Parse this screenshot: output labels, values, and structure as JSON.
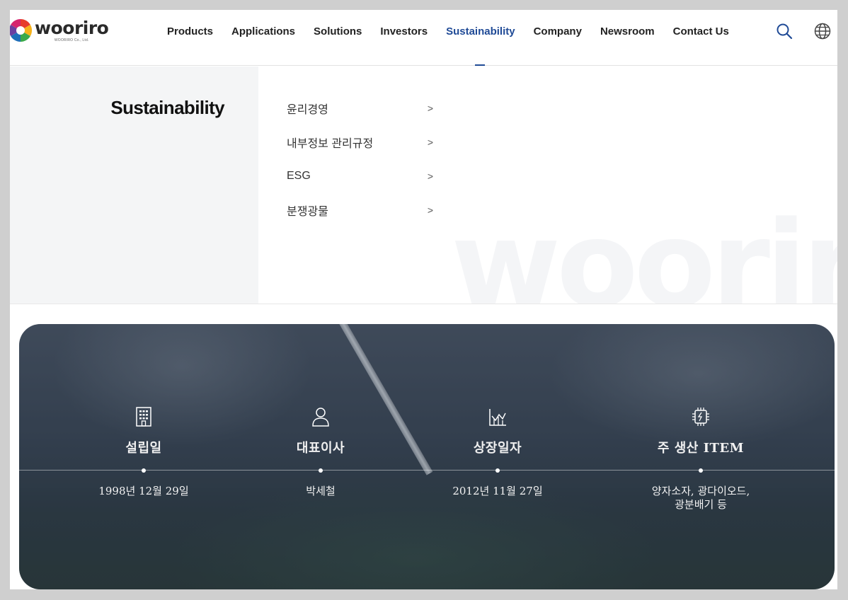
{
  "header": {
    "logo": {
      "name": "wooriro",
      "sub": "WOORIRO Co., Ltd."
    },
    "nav": [
      {
        "label": "Products"
      },
      {
        "label": "Applications"
      },
      {
        "label": "Solutions"
      },
      {
        "label": "Investors"
      },
      {
        "label": "Sustainability",
        "active": true
      },
      {
        "label": "Company"
      },
      {
        "label": "Newsroom"
      },
      {
        "label": "Contact Us"
      }
    ],
    "icons": [
      "search-icon",
      "globe-icon"
    ],
    "accent_color": "#1f4a96"
  },
  "mega_menu": {
    "title": "Sustainability",
    "items": [
      {
        "label": "윤리경영"
      },
      {
        "label": "내부정보 관리규정"
      },
      {
        "label": "ESG"
      },
      {
        "label": "분쟁광물"
      }
    ],
    "watermark": "wooriro"
  },
  "stats": [
    {
      "icon": "building-icon",
      "label": "설립일",
      "value": "1998년 12월 29일"
    },
    {
      "icon": "user-icon",
      "label": "대표이사",
      "value": "박세철"
    },
    {
      "icon": "chart-icon",
      "label": "상장일자",
      "value": "2012년 11월 27일"
    },
    {
      "icon": "chip-icon",
      "label": "주 생산 ITEM",
      "value": "양자소자, 광다이오드,\n광분배기 등"
    }
  ]
}
